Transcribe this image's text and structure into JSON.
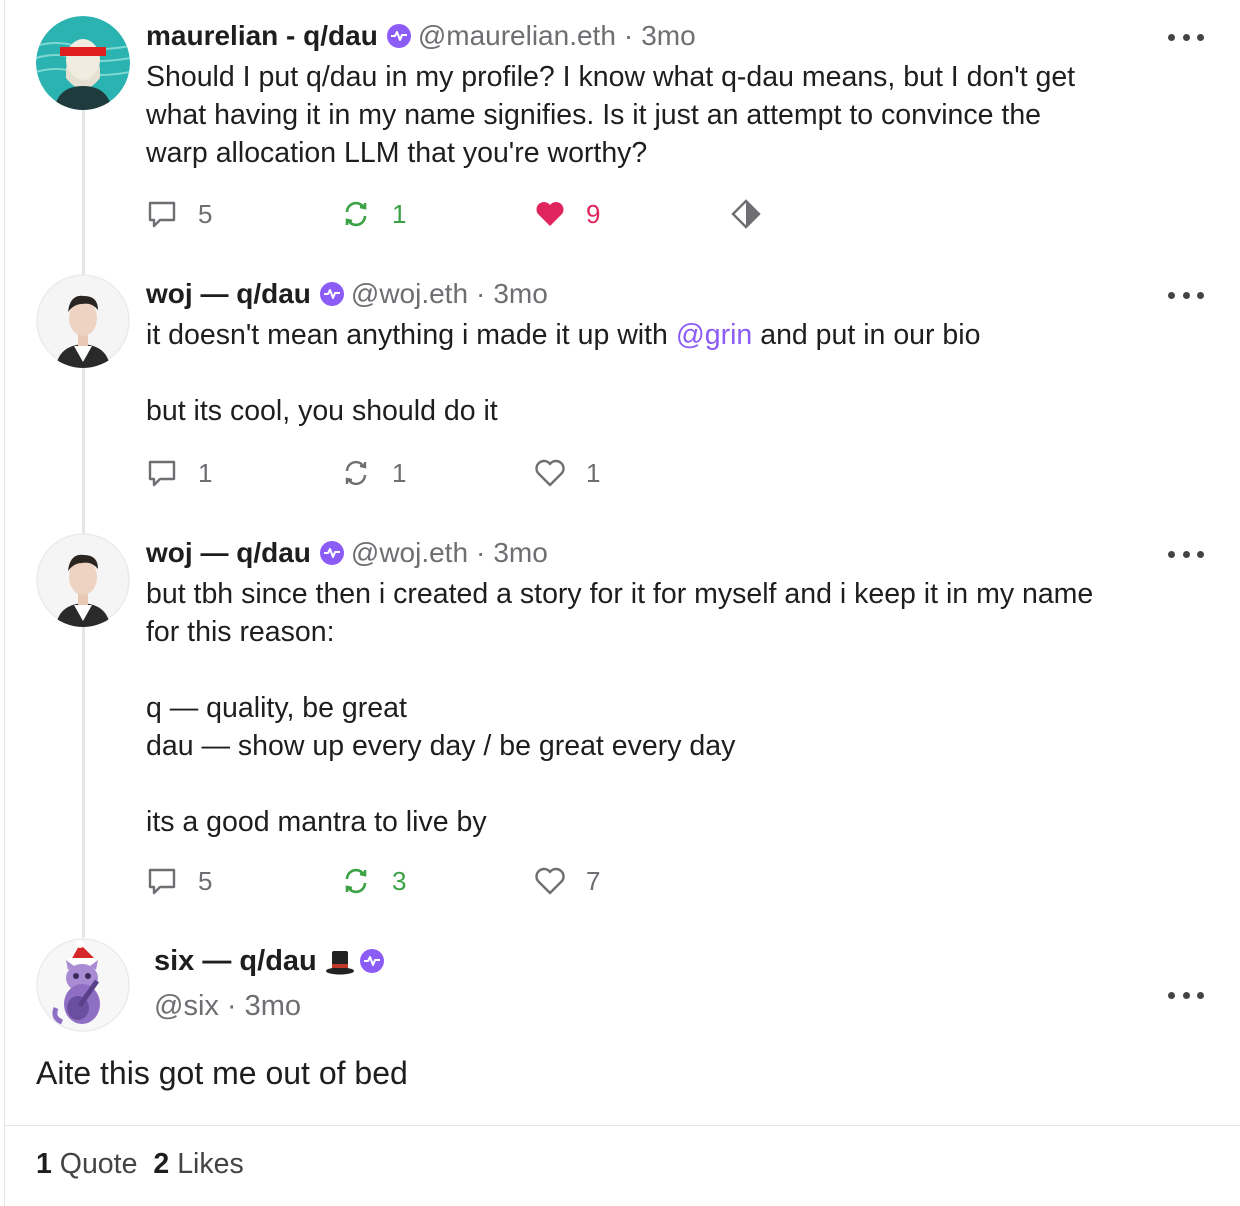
{
  "casts": [
    {
      "name": "maurelian - q/dau",
      "handle": "@maurelian.eth",
      "time": "3mo",
      "lines": [
        "Should I put q/dau in my profile? I know what q-dau means, but I don't get",
        "what having it in my name signifies. Is it just an attempt to convince the",
        "warp allocation LLM that you're worthy?"
      ],
      "replies": "5",
      "recasts": "1",
      "likes": "9"
    },
    {
      "name": "woj — q/dau",
      "handle": "@woj.eth",
      "time": "3mo",
      "line1_pre": "it doesn't mean anything i made it up with ",
      "mention": "@grin",
      "line1_post": " and put in our bio",
      "line2": "but its cool, you should do it",
      "replies": "1",
      "recasts": "1",
      "likes": "1"
    },
    {
      "name": "woj — q/dau",
      "handle": "@woj.eth",
      "time": "3mo",
      "lines": [
        "but tbh since then i created a story for it for myself and i keep it in my name",
        "for this reason:",
        "",
        "q — quality, be great",
        "dau — show up every day / be great every day",
        "",
        "its a good mantra to live by"
      ],
      "replies": "5",
      "recasts": "3",
      "likes": "7"
    }
  ],
  "main": {
    "name": "six — q/dau",
    "handle": "@six",
    "time": "3mo",
    "text": "Aite this got me out of bed"
  },
  "stats": {
    "quotes_count": "1",
    "quotes_label": "Quote",
    "likes_count": "2",
    "likes_label": "Likes"
  },
  "separator": "·",
  "icons": {
    "reply": "reply-icon",
    "recast": "recast-icon",
    "like": "heart-icon",
    "more": "more-icon",
    "verified": "verified-badge-icon",
    "hat": "top-hat-emoji",
    "tip": "diamond-icon"
  },
  "colors": {
    "accent": "#8b5cf6",
    "recast_active": "#3aa244",
    "like_active": "#e0245e",
    "muted": "#6e6e73"
  }
}
